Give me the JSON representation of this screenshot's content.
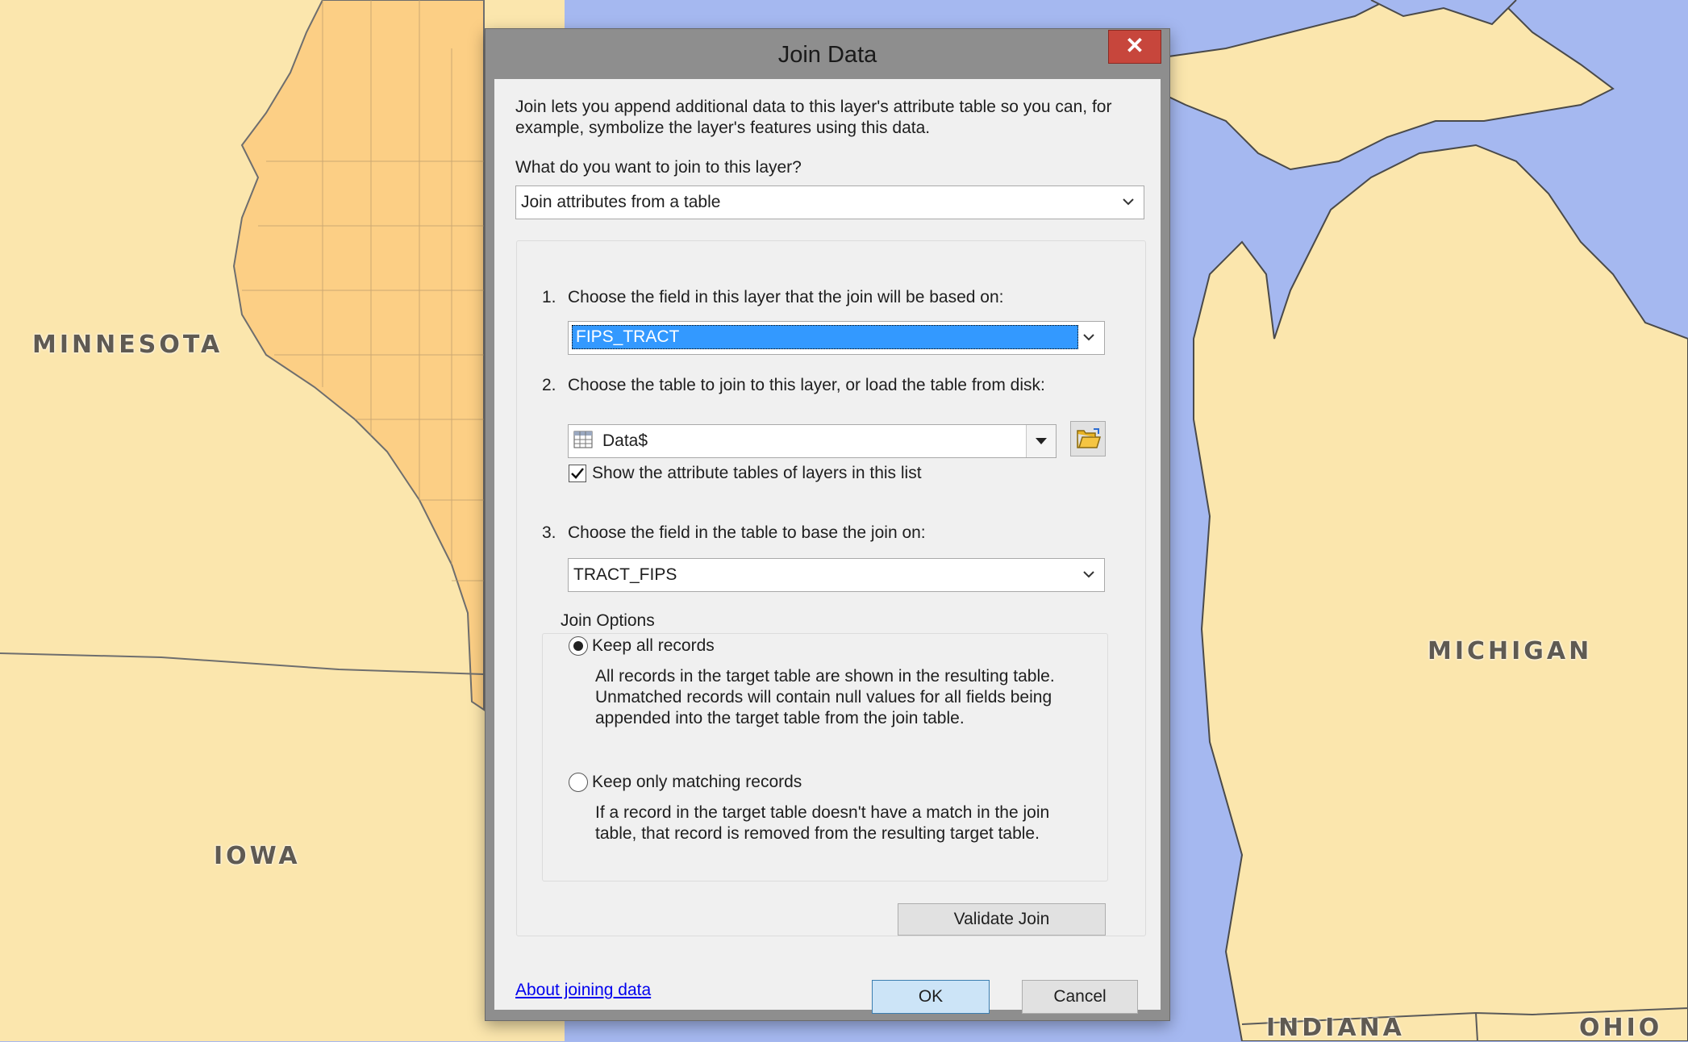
{
  "map": {
    "labels": {
      "minnesota": "MINNESOTA",
      "iowa": "IOWA",
      "michigan": "MICHIGAN",
      "indiana": "INDIANA",
      "ohio": "OHIO"
    },
    "colors": {
      "water": "#a5b8f0",
      "land": "#fbe6ad",
      "selected_state": "#fccf85",
      "borders": "#5a5a5a"
    }
  },
  "dialog": {
    "title": "Join Data",
    "close_label": "✕",
    "intro": "Join lets you append additional data to this layer's attribute table so you can, for example, symbolize the layer's features using this data.",
    "question": "What do you want to join to this layer?",
    "join_type": {
      "value": "Join attributes from a table"
    },
    "step1": {
      "number": "1.",
      "label": "Choose the field in this layer that the join will be based on:",
      "value": "FIPS_TRACT"
    },
    "step2": {
      "number": "2.",
      "label": "Choose the table to join to this layer, or load the table from disk:",
      "value": "Data$",
      "table_icon": "table-icon",
      "open_icon": "folder-open-icon",
      "show_layers_checkbox": {
        "label": "Show the attribute tables of layers in this list",
        "checked": true
      }
    },
    "step3": {
      "number": "3.",
      "label": "Choose the field in the table to base the join on:",
      "value": "TRACT_FIPS"
    },
    "join_options": {
      "legend": "Join Options",
      "keep_all": {
        "label": "Keep all records",
        "selected": true,
        "desc1": "All records in the target table are shown in the resulting table.",
        "desc2": "Unmatched records will contain null values for all fields being",
        "desc3": "appended into the target table from the join table."
      },
      "keep_matching": {
        "label": "Keep only matching records",
        "selected": false,
        "desc1": "If a record in the target table doesn't have a match in the join",
        "desc2": "table, that record is removed from the resulting target table."
      }
    },
    "validate_label": "Validate Join",
    "about_link": "About joining data",
    "ok_label": "OK",
    "cancel_label": "Cancel"
  }
}
